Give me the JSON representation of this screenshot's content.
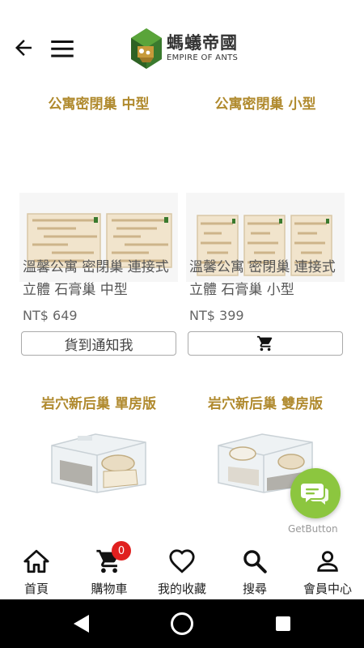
{
  "header": {
    "logo_cn": "螞蟻帝國",
    "logo_en": "EMPIRE OF ANTS"
  },
  "products": [
    {
      "tag": "公寓密閉巢 中型",
      "title": "溫馨公寓 密閉巢 連接式 立體 石膏巢 中型",
      "price": "NT$ 649",
      "button_label": "貨到通知我",
      "button_icon": "cart-icon"
    },
    {
      "tag": "公寓密閉巢 小型",
      "title": "溫馨公寓 密閉巢 連接式 立體 石膏巢 小型",
      "price": "NT$ 399",
      "button_label": "",
      "button_icon": "cart-icon"
    },
    {
      "tag": "岩穴新后巢 單房版"
    },
    {
      "tag": "岩穴新后巢 雙房版"
    }
  ],
  "chat": {
    "label": "GetButton",
    "color": "#8cc63f"
  },
  "bottom_nav": {
    "items": [
      {
        "label": "首頁",
        "icon": "home-icon"
      },
      {
        "label": "購物車",
        "icon": "cart-icon",
        "badge": "0"
      },
      {
        "label": "我的收藏",
        "icon": "heart-icon"
      },
      {
        "label": "搜尋",
        "icon": "search-icon"
      },
      {
        "label": "會員中心",
        "icon": "person-icon"
      }
    ]
  },
  "colors": {
    "accent_gold": "#b08a2e",
    "badge_red": "#e0201f"
  }
}
